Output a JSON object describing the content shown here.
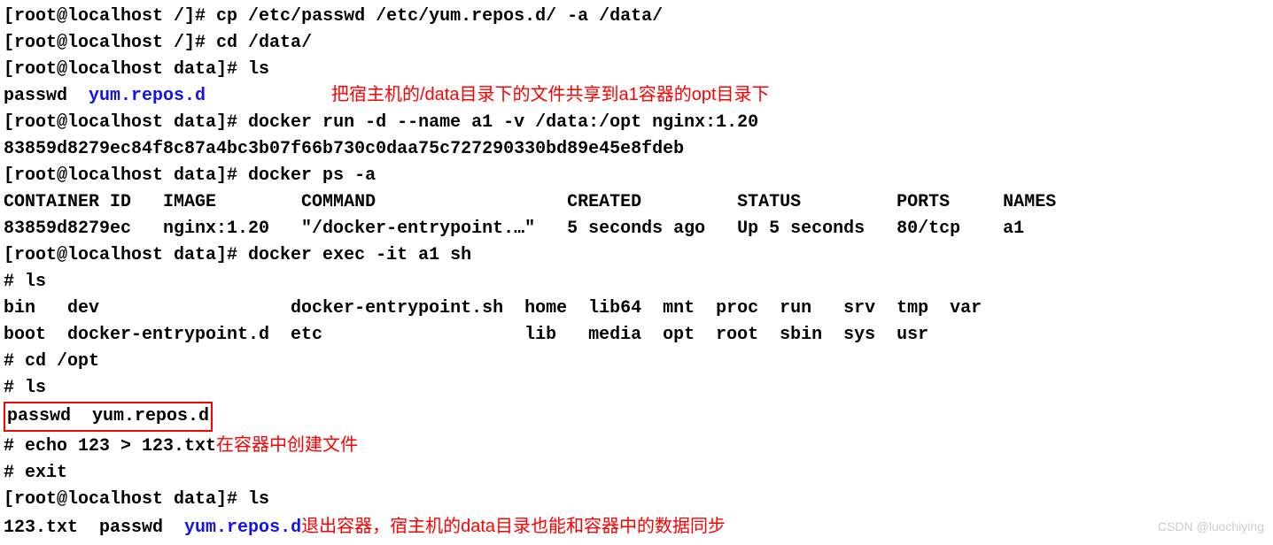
{
  "lines": {
    "l1_prompt": "[root@localhost /]# ",
    "l1_cmd": "cp /etc/passwd /etc/yum.repos.d/ -a /data/",
    "l2_prompt": "[root@localhost /]# ",
    "l2_cmd": "cd /data/",
    "l3_prompt": "[root@localhost data]# ",
    "l3_cmd": "ls",
    "l4_file1": "passwd  ",
    "l4_dir": "yum.repos.d",
    "note1": "把宿主机的/data目录下的文件共享到a1容器的opt目录下",
    "l5_prompt": "[root@localhost data]# ",
    "l5_cmd": "docker run -d --name a1 -v /data:/opt nginx:1.20",
    "l6": "83859d8279ec84f8c87a4bc3b07f66b730c0daa75c727290330bd89e45e8fdeb",
    "l7_prompt": "[root@localhost data]# ",
    "l7_cmd": "docker ps -a",
    "l8": "CONTAINER ID   IMAGE        COMMAND                  CREATED         STATUS         PORTS     NAMES",
    "l9": "83859d8279ec   nginx:1.20   \"/docker-entrypoint.…\"   5 seconds ago   Up 5 seconds   80/tcp    a1",
    "l10_prompt": "[root@localhost data]# ",
    "l10_cmd": "docker exec -it a1 sh",
    "l11": "# ls",
    "l12": "bin   dev                  docker-entrypoint.sh  home  lib64  mnt  proc  run   srv  tmp  var",
    "l13": "boot  docker-entrypoint.d  etc                   lib   media  opt  root  sbin  sys  usr",
    "l14": "# cd /opt",
    "l15": "# ls",
    "l16": "passwd  yum.repos.d",
    "l17_pre": "# echo 123 > 123.txt",
    "note2": "在容器中创建文件",
    "l18": "# exit",
    "l19_prompt": "[root@localhost data]# ",
    "l19_cmd": "ls",
    "l20_a": "123.txt  passwd  ",
    "l20_dir": "yum.repos.d",
    "note3": "退出容器，宿主机的data目录也能和容器中的数据同步"
  },
  "watermark": "CSDN @luochiying"
}
